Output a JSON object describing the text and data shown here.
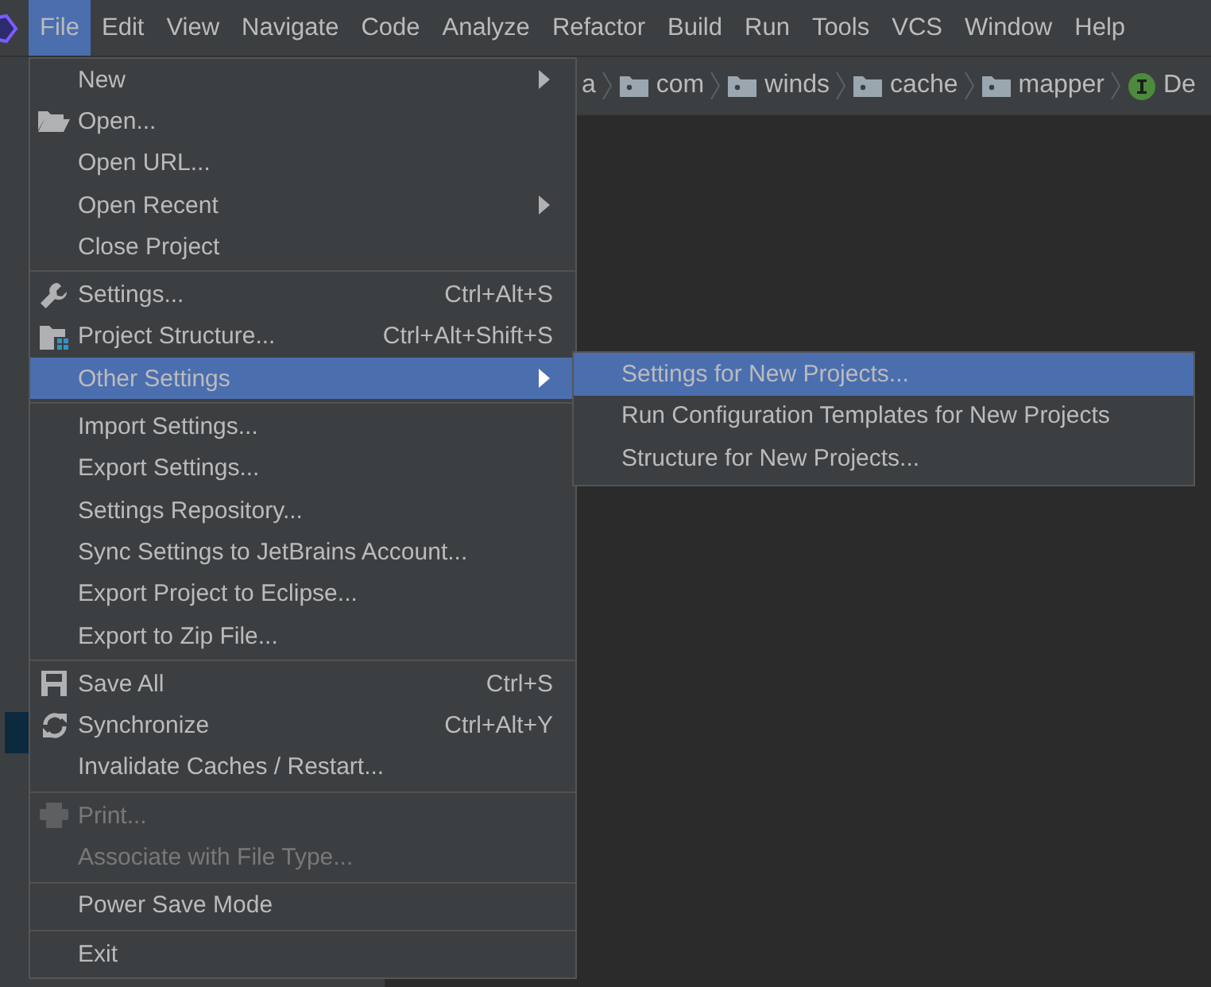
{
  "menubar": [
    {
      "label": "File",
      "selected": true
    },
    {
      "label": "Edit",
      "selected": false
    },
    {
      "label": "View",
      "selected": false
    },
    {
      "label": "Navigate",
      "selected": false
    },
    {
      "label": "Code",
      "selected": false
    },
    {
      "label": "Analyze",
      "selected": false
    },
    {
      "label": "Refactor",
      "selected": false
    },
    {
      "label": "Build",
      "selected": false
    },
    {
      "label": "Run",
      "selected": false
    },
    {
      "label": "Tools",
      "selected": false
    },
    {
      "label": "VCS",
      "selected": false
    },
    {
      "label": "Window",
      "selected": false
    },
    {
      "label": "Help",
      "selected": false
    }
  ],
  "breadcrumbs": [
    {
      "kind": "text",
      "label": "a"
    },
    {
      "kind": "folder",
      "label": "com"
    },
    {
      "kind": "folder",
      "label": "winds"
    },
    {
      "kind": "folder",
      "label": "cache"
    },
    {
      "kind": "folder",
      "label": "mapper"
    },
    {
      "kind": "interface",
      "label": "De"
    }
  ],
  "file_menu": {
    "groups": [
      [
        {
          "label": "New",
          "submenu": true,
          "selected": false,
          "disabled": false
        },
        {
          "label": "Open...",
          "submenu": false,
          "selected": false,
          "disabled": false
        },
        {
          "label": "Open URL...",
          "submenu": false,
          "selected": false,
          "disabled": false
        },
        {
          "label": "Open Recent",
          "submenu": true,
          "selected": false,
          "disabled": false
        },
        {
          "label": "Close Project",
          "submenu": false,
          "selected": false,
          "disabled": false
        }
      ],
      [
        {
          "label": "Settings...",
          "shortcut": "Ctrl+Alt+S",
          "submenu": false,
          "selected": false,
          "disabled": false
        },
        {
          "label": "Project Structure...",
          "shortcut": "Ctrl+Alt+Shift+S",
          "submenu": false,
          "selected": false,
          "disabled": false
        },
        {
          "label": "Other Settings",
          "submenu": true,
          "selected": true,
          "disabled": false
        }
      ],
      [
        {
          "label": "Import Settings...",
          "submenu": false,
          "selected": false,
          "disabled": false
        },
        {
          "label": "Export Settings...",
          "submenu": false,
          "selected": false,
          "disabled": false
        },
        {
          "label": "Settings Repository...",
          "submenu": false,
          "selected": false,
          "disabled": false
        },
        {
          "label": "Sync Settings to JetBrains Account...",
          "submenu": false,
          "selected": false,
          "disabled": false
        },
        {
          "label": "Export Project to Eclipse...",
          "submenu": false,
          "selected": false,
          "disabled": false
        },
        {
          "label": "Export to Zip File...",
          "submenu": false,
          "selected": false,
          "disabled": false
        }
      ],
      [
        {
          "label": "Save All",
          "shortcut": "Ctrl+S",
          "submenu": false,
          "selected": false,
          "disabled": false
        },
        {
          "label": "Synchronize",
          "shortcut": "Ctrl+Alt+Y",
          "submenu": false,
          "selected": false,
          "disabled": false
        },
        {
          "label": "Invalidate Caches / Restart...",
          "submenu": false,
          "selected": false,
          "disabled": false
        }
      ],
      [
        {
          "label": "Print...",
          "submenu": false,
          "selected": false,
          "disabled": true
        },
        {
          "label": "Associate with File Type...",
          "submenu": false,
          "selected": false,
          "disabled": true
        }
      ],
      [
        {
          "label": "Power Save Mode",
          "submenu": false,
          "selected": false,
          "disabled": false
        }
      ],
      [
        {
          "label": "Exit",
          "submenu": false,
          "selected": false,
          "disabled": false
        }
      ]
    ]
  },
  "other_settings_submenu": [
    {
      "label": "Settings for New Projects...",
      "selected": true
    },
    {
      "label": "Run Configuration Templates for New Projects",
      "selected": false
    },
    {
      "label": "Structure for New Projects...",
      "selected": false
    }
  ]
}
